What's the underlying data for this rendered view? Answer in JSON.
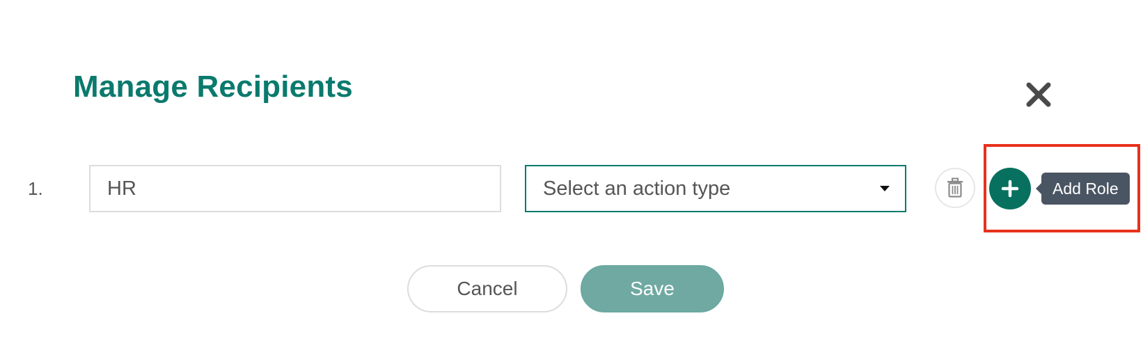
{
  "modal": {
    "title": "Manage Recipients",
    "close_icon": "close-icon"
  },
  "recipients": [
    {
      "number": "1.",
      "role_value": "HR",
      "action_type_placeholder": "Select an action type",
      "delete_icon": "trash-icon",
      "add_icon": "plus-icon"
    }
  ],
  "tooltip": {
    "text": "Add Role"
  },
  "footer": {
    "cancel_label": "Cancel",
    "save_label": "Save"
  },
  "colors": {
    "accent": "#0a7a6d",
    "add_button": "#08705f",
    "save_button": "#6fa9a2",
    "tooltip_bg": "#4a5563",
    "highlight": "#e8301c"
  }
}
